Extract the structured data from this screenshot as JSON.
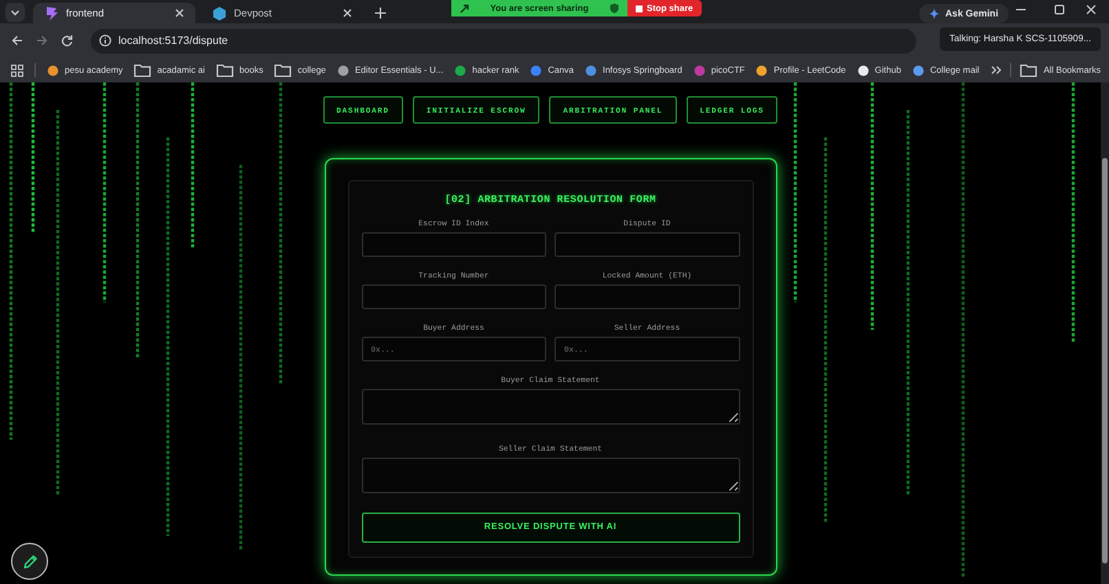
{
  "browser": {
    "tabs": [
      {
        "title": "frontend",
        "selected": true
      },
      {
        "title": "Devpost",
        "selected": false
      }
    ],
    "address": "localhost:5173/dispute",
    "bookmarks": [
      {
        "label": "pesu academy",
        "kind": "site",
        "color": "#e8912d"
      },
      {
        "label": "acadamic ai",
        "kind": "folder"
      },
      {
        "label": "books",
        "kind": "folder"
      },
      {
        "label": "college",
        "kind": "folder"
      },
      {
        "label": "Editor Essentials - U...",
        "kind": "site",
        "color": "#9aa0a6"
      },
      {
        "label": "hacker rank",
        "kind": "site",
        "color": "#1ba94c"
      },
      {
        "label": "Canva",
        "kind": "site",
        "color": "#3b82f6"
      },
      {
        "label": "Infosys Springboard",
        "kind": "site",
        "color": "#4f8fe0"
      },
      {
        "label": "picoCTF",
        "kind": "site",
        "color": "#c0399f"
      },
      {
        "label": "Profile - LeetCode",
        "kind": "site",
        "color": "#f0a12c"
      },
      {
        "label": "Github",
        "kind": "site",
        "color": "#e8eaed"
      },
      {
        "label": "College mail",
        "kind": "site",
        "color": "#5b9bf0"
      }
    ],
    "all_bookmarks": "All Bookmarks",
    "ask_gemini": "Ask Gemini",
    "tooltip": "Talking: Harsha K SCS-1105909..."
  },
  "share_banner": {
    "text": "You are screen sharing",
    "stop": "Stop share"
  },
  "page": {
    "nav": [
      "DASHBOARD",
      "INITIALIZE ESCROW",
      "ARBITRATION PANEL",
      "LEDGER LOGS"
    ],
    "form": {
      "title": "[02] ARBITRATION RESOLUTION FORM",
      "fields": [
        {
          "label": "Escrow ID Index",
          "kind": "input"
        },
        {
          "label": "Dispute ID",
          "kind": "input"
        },
        {
          "label": "Tracking Number",
          "kind": "input"
        },
        {
          "label": "Locked Amount (ETH)",
          "kind": "input"
        },
        {
          "label": "Buyer Address",
          "kind": "input",
          "placeholder": "0x..."
        },
        {
          "label": "Seller Address",
          "kind": "input",
          "placeholder": "0x..."
        },
        {
          "label": "Buyer Claim Statement",
          "kind": "textarea"
        },
        {
          "label": "Seller Claim Statement",
          "kind": "textarea"
        }
      ],
      "submit": "RESOLVE DISPUTE WITH AI"
    }
  }
}
